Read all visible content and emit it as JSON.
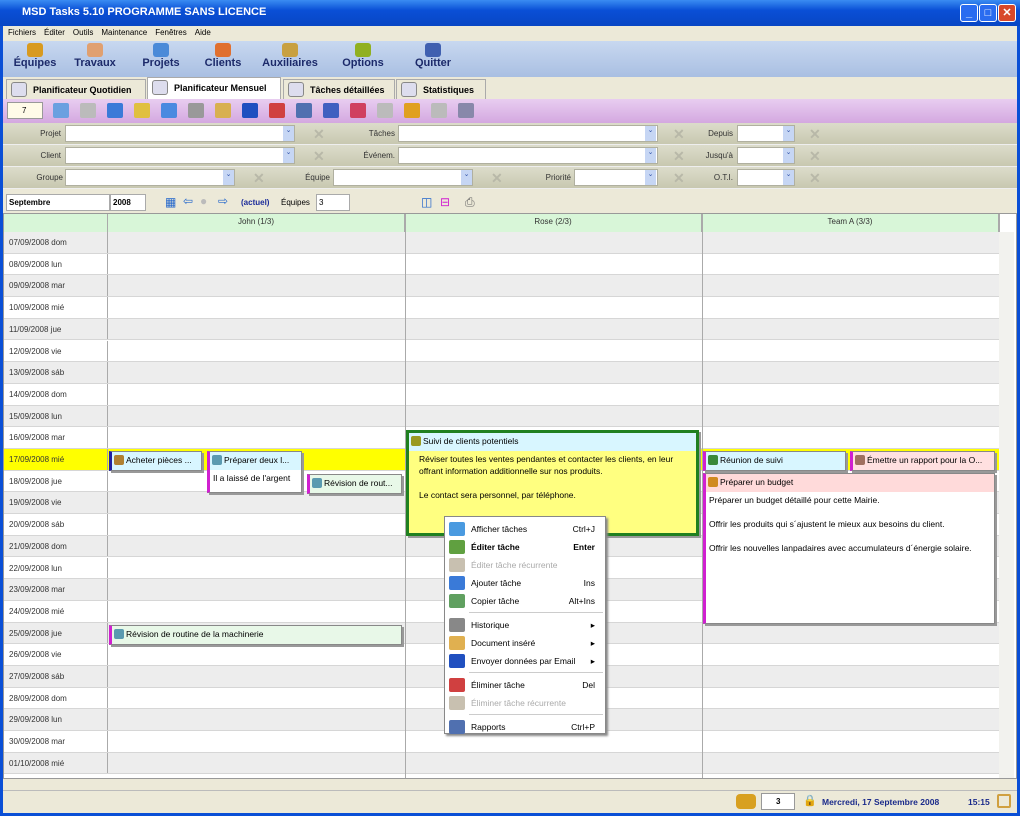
{
  "window": {
    "title": "MSD Tasks 5.10 PROGRAMME SANS LICENCE"
  },
  "menu": [
    "Fichiers",
    "Éditer",
    "Outils",
    "Maintenance",
    "Fenêtres",
    "Aide"
  ],
  "bigbar": [
    {
      "label": "Équipes",
      "color": "#d89a20"
    },
    {
      "label": "Travaux",
      "color": "#e0a070"
    },
    {
      "label": "Projets",
      "color": "#4a8ad8"
    },
    {
      "label": "Clients",
      "color": "#e07030"
    },
    {
      "label": "Auxiliaires",
      "color": "#c8a040"
    },
    {
      "label": "Options",
      "color": "#90b020"
    },
    {
      "label": "Quitter",
      "color": "#4060b0"
    }
  ],
  "tabs": [
    {
      "label": "Planificateur Quotidien"
    },
    {
      "label": "Planificateur Mensuel",
      "active": true
    },
    {
      "label": "Tâches détaillées"
    },
    {
      "label": "Statistiques"
    }
  ],
  "toolbar": {
    "day_value": "7"
  },
  "filters": {
    "projet": "Projet",
    "taches": "Tâches",
    "depuis": "Depuis",
    "client": "Client",
    "evenem": "Événem.",
    "jusqua": "Jusqu'à",
    "groupe": "Groupe",
    "equipe": "Équipe",
    "priorite": "Priorité",
    "oti": "O.T.I."
  },
  "nav": {
    "month": "Septembre",
    "year": "2008",
    "actuel": "(actuel)",
    "equipes_label": "Équipes",
    "equipes_value": "3"
  },
  "columns": [
    "John  (1/3)",
    "Rose  (2/3)",
    "Team A  (3/3)"
  ],
  "rows": [
    "07/09/2008 dom",
    "08/09/2008 lun",
    "09/09/2008 mar",
    "10/09/2008 mié",
    "11/09/2008 jue",
    "12/09/2008 vie",
    "13/09/2008 sáb",
    "14/09/2008 dom",
    "15/09/2008 lun",
    "16/09/2008 mar",
    "17/09/2008 mié",
    "18/09/2008 jue",
    "19/09/2008 vie",
    "20/09/2008 sáb",
    "21/09/2008 dom",
    "22/09/2008 lun",
    "23/09/2008 mar",
    "24/09/2008 mié",
    "25/09/2008 jue",
    "26/09/2008 vie",
    "27/09/2008 sáb",
    "28/09/2008 dom",
    "29/09/2008 lun",
    "30/09/2008 mar",
    "01/10/2008 mié"
  ],
  "today_index": 10,
  "events": {
    "acheter": {
      "title": "Acheter pièces ..."
    },
    "preparer_deux": {
      "title": "Préparer deux l...",
      "body": "Il a laissé de l'argent"
    },
    "revision_rout": {
      "title": "Révision de rout..."
    },
    "suivi": {
      "title": "Suivi de clients potentiels",
      "body1": "Réviser toutes les ventes pendantes et contacter les clients, en leur offrant information additionnelle sur nos produits.",
      "body2": "Le contact sera personnel, par téléphone."
    },
    "reunion": {
      "title": "Réunion de suivi"
    },
    "emettre": {
      "title": "Émettre un rapport pour la O..."
    },
    "budget": {
      "title": "Préparer un budget",
      "body1": "Préparer un budget détaillé pour cette Mairie.",
      "body2": "Offrir les produits qui s´ajustent le mieux aux besoins du client.",
      "body3": "Offrir les nouvelles lanpadaires avec accumulateurs d´énergie solaire."
    },
    "revision_machinerie": {
      "title": "Révision de routine de la machinerie"
    }
  },
  "context_menu": [
    {
      "label": "Afficher tâches",
      "shortcut": "Ctrl+J",
      "icon": "monitor-icon"
    },
    {
      "label": "Éditer tâche",
      "shortcut": "Enter",
      "icon": "edit-icon",
      "bold": true
    },
    {
      "label": "Éditer tâche récurrente",
      "shortcut": "",
      "icon": "folder-icon",
      "disabled": true
    },
    {
      "label": "Ajouter tâche",
      "shortcut": "Ins",
      "icon": "add-icon"
    },
    {
      "label": "Copier tâche",
      "shortcut": "Alt+Ins",
      "icon": "copy-icon"
    },
    {
      "label": "Historique",
      "shortcut": "▸",
      "icon": "history-icon"
    },
    {
      "label": "Document inséré",
      "shortcut": "▸",
      "icon": "document-icon"
    },
    {
      "label": "Envoyer données par Email",
      "shortcut": "▸",
      "icon": "email-icon"
    },
    {
      "label": "Éliminer tâche",
      "shortcut": "Del",
      "icon": "delete-icon"
    },
    {
      "label": "Éliminer tâche récurrente",
      "shortcut": "",
      "icon": "folder-icon",
      "disabled": true
    },
    {
      "label": "Rapports",
      "shortcut": "Ctrl+P",
      "icon": "print-icon"
    }
  ],
  "status": {
    "count": "3",
    "date": "Mercredi, 17 Septembre 2008",
    "time": "15:15"
  }
}
